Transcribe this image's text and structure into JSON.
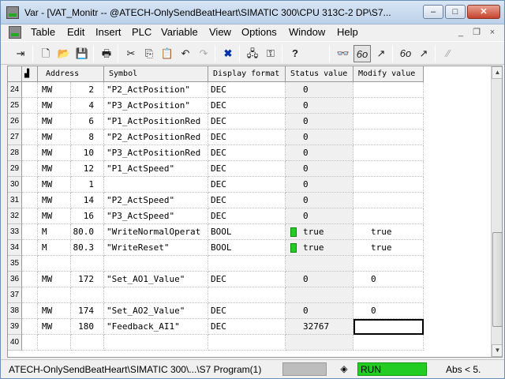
{
  "window": {
    "title": "Var - [VAT_Monitr -- @ATECH-OnlySendBeatHeart\\SIMATIC 300\\CPU 313C-2 DP\\S7...",
    "minimize_glyph": "–",
    "maximize_glyph": "□",
    "close_glyph": "✕"
  },
  "menu": {
    "items": [
      "Table",
      "Edit",
      "Insert",
      "PLC",
      "Variable",
      "View",
      "Options",
      "Window",
      "Help"
    ],
    "mdi_glyphs": [
      "_",
      "❐",
      "×"
    ]
  },
  "toolbar": {
    "buttons": [
      {
        "name": "insert-line-icon",
        "glyph": "⇥"
      },
      {
        "name": "new-icon",
        "glyph": "🗋"
      },
      {
        "name": "open-icon",
        "glyph": "📂"
      },
      {
        "name": "save-icon",
        "glyph": "💾"
      },
      {
        "name": "print-icon",
        "glyph": "🖶"
      },
      {
        "name": "cut-icon",
        "glyph": "✂"
      },
      {
        "name": "copy-icon",
        "glyph": "⎘"
      },
      {
        "name": "paste-icon",
        "glyph": "📋"
      },
      {
        "name": "undo-icon",
        "glyph": "↶"
      },
      {
        "name": "redo-icon",
        "glyph": "↷"
      },
      {
        "name": "disconnect-icon",
        "glyph": "✖"
      },
      {
        "name": "online-icon",
        "glyph": "🖧"
      },
      {
        "name": "accessible-nodes-icon",
        "glyph": "⚿"
      },
      {
        "name": "help-icon",
        "glyph": "?"
      },
      {
        "name": "monitor-variable-icon",
        "glyph": "👓"
      },
      {
        "name": "monitor-icon",
        "glyph": "6o"
      },
      {
        "name": "modify-icon",
        "glyph": "↗"
      },
      {
        "name": "update-monitor-icon",
        "glyph": "6o"
      },
      {
        "name": "activate-modify-icon",
        "glyph": "↗"
      },
      {
        "name": "force-icon",
        "glyph": "⁄⁄"
      }
    ]
  },
  "table": {
    "headers": {
      "address": "Address",
      "symbol": "Symbol",
      "display_format": "Display format",
      "status_value": "Status value",
      "modify_value": "Modify value"
    },
    "rows": [
      {
        "num": "24",
        "op": "MW",
        "addr": "2",
        "symbol": "\"P2_ActPosition\"",
        "format": "DEC",
        "status": "0",
        "modify": "",
        "led": false
      },
      {
        "num": "25",
        "op": "MW",
        "addr": "4",
        "symbol": "\"P3_ActPosition\"",
        "format": "DEC",
        "status": "0",
        "modify": "",
        "led": false
      },
      {
        "num": "26",
        "op": "MW",
        "addr": "6",
        "symbol": "\"P1_ActPositionRed",
        "format": "DEC",
        "status": "0",
        "modify": "",
        "led": false
      },
      {
        "num": "27",
        "op": "MW",
        "addr": "8",
        "symbol": "\"P2_ActPositionRed",
        "format": "DEC",
        "status": "0",
        "modify": "",
        "led": false
      },
      {
        "num": "28",
        "op": "MW",
        "addr": "10",
        "symbol": "\"P3_ActPositionRed",
        "format": "DEC",
        "status": "0",
        "modify": "",
        "led": false
      },
      {
        "num": "29",
        "op": "MW",
        "addr": "12",
        "symbol": "\"P1_ActSpeed\"",
        "format": "DEC",
        "status": "0",
        "modify": "",
        "led": false
      },
      {
        "num": "30",
        "op": "MW",
        "addr": "1",
        "symbol": "",
        "format": "DEC",
        "status": "0",
        "modify": "",
        "led": false
      },
      {
        "num": "31",
        "op": "MW",
        "addr": "14",
        "symbol": "\"P2_ActSpeed\"",
        "format": "DEC",
        "status": "0",
        "modify": "",
        "led": false
      },
      {
        "num": "32",
        "op": "MW",
        "addr": "16",
        "symbol": "\"P3_ActSpeed\"",
        "format": "DEC",
        "status": "0",
        "modify": "",
        "led": false
      },
      {
        "num": "33",
        "op": "M",
        "addr": "80.0",
        "symbol": "\"WriteNormalOperat",
        "format": "BOOL",
        "status": "true",
        "modify": "true",
        "led": true
      },
      {
        "num": "34",
        "op": "M",
        "addr": "80.3",
        "symbol": "\"WriteReset\"",
        "format": "BOOL",
        "status": "true",
        "modify": "true",
        "led": true
      },
      {
        "num": "35",
        "op": "",
        "addr": "",
        "symbol": "",
        "format": "",
        "status": "",
        "modify": "",
        "led": false
      },
      {
        "num": "36",
        "op": "MW",
        "addr": "172",
        "symbol": "\"Set_AO1_Value\"",
        "format": "DEC",
        "status": "0",
        "modify": "0",
        "led": false
      },
      {
        "num": "37",
        "op": "",
        "addr": "",
        "symbol": "",
        "format": "",
        "status": "",
        "modify": "",
        "led": false
      },
      {
        "num": "38",
        "op": "MW",
        "addr": "174",
        "symbol": "\"Set_AO2_Value\"",
        "format": "DEC",
        "status": "0",
        "modify": "0",
        "led": false
      },
      {
        "num": "39",
        "op": "MW",
        "addr": "180",
        "symbol": "\"Feedback_AI1\"",
        "format": "DEC",
        "status": "32767",
        "modify": "",
        "led": false,
        "selected_modify": true
      },
      {
        "num": "40",
        "op": "",
        "addr": "",
        "symbol": "",
        "format": "",
        "status": "",
        "modify": "",
        "led": false
      }
    ]
  },
  "statusbar": {
    "path": "ATECH-OnlySendBeatHeart\\SIMATIC 300\\...\\S7 Program(1)",
    "diamond_glyph": "◈",
    "run_state": "RUN",
    "mode": "Abs < 5."
  },
  "colors": {
    "run_green": "#22cc22",
    "led_green": "#22cc22"
  }
}
